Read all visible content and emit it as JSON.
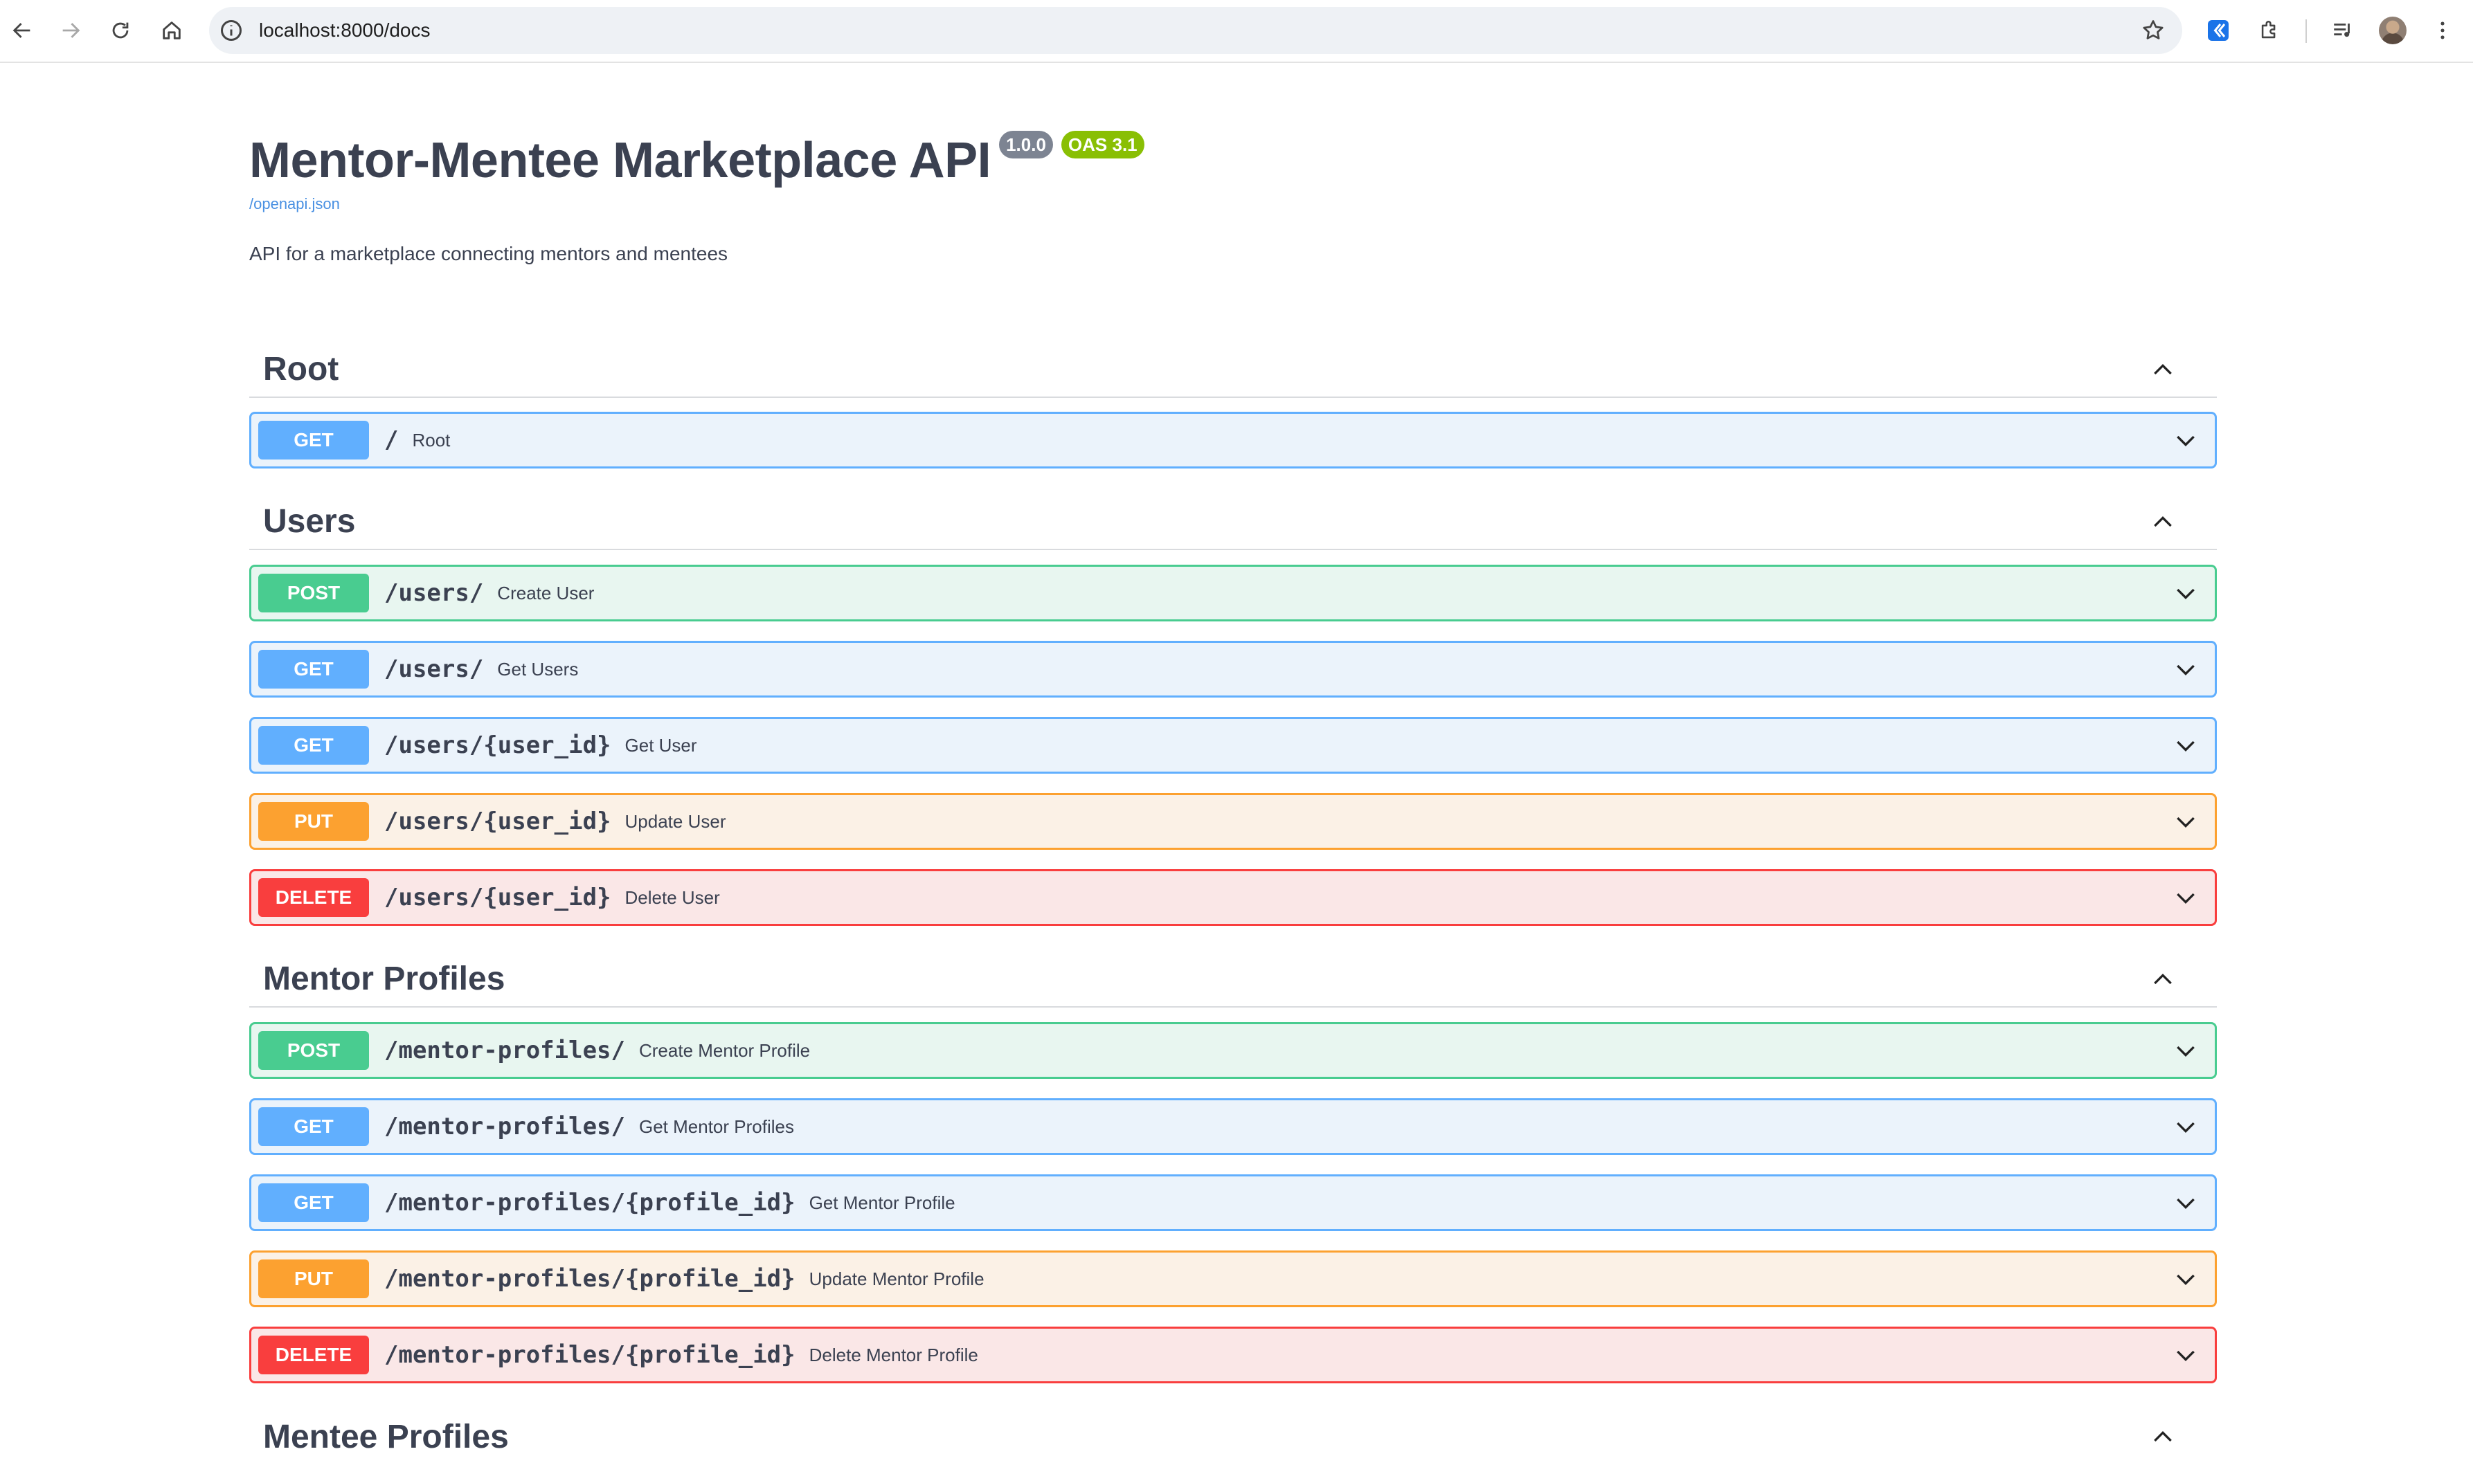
{
  "browser": {
    "url": "localhost:8000/docs"
  },
  "api": {
    "title": "Mentor-Mentee Marketplace API",
    "version": "1.0.0",
    "oas": "OAS 3.1",
    "spec_link": "/openapi.json",
    "description": "API for a marketplace connecting mentors and mentees"
  },
  "tags": [
    {
      "name": "Root",
      "operations": [
        {
          "method": "GET",
          "path": "/",
          "summary": "Root"
        }
      ]
    },
    {
      "name": "Users",
      "operations": [
        {
          "method": "POST",
          "path": "/users/",
          "summary": "Create User"
        },
        {
          "method": "GET",
          "path": "/users/",
          "summary": "Get Users"
        },
        {
          "method": "GET",
          "path": "/users/{user_id}",
          "summary": "Get User"
        },
        {
          "method": "PUT",
          "path": "/users/{user_id}",
          "summary": "Update User"
        },
        {
          "method": "DELETE",
          "path": "/users/{user_id}",
          "summary": "Delete User"
        }
      ]
    },
    {
      "name": "Mentor Profiles",
      "operations": [
        {
          "method": "POST",
          "path": "/mentor-profiles/",
          "summary": "Create Mentor Profile"
        },
        {
          "method": "GET",
          "path": "/mentor-profiles/",
          "summary": "Get Mentor Profiles"
        },
        {
          "method": "GET",
          "path": "/mentor-profiles/{profile_id}",
          "summary": "Get Mentor Profile"
        },
        {
          "method": "PUT",
          "path": "/mentor-profiles/{profile_id}",
          "summary": "Update Mentor Profile"
        },
        {
          "method": "DELETE",
          "path": "/mentor-profiles/{profile_id}",
          "summary": "Delete Mentor Profile"
        }
      ]
    },
    {
      "name": "Mentee Profiles",
      "operations": []
    }
  ],
  "colors": {
    "get": "#61affe",
    "post": "#49cc90",
    "put": "#fca130",
    "delete": "#f93e3e",
    "oas_badge": "#89bf04",
    "version_badge": "#7d8492"
  }
}
